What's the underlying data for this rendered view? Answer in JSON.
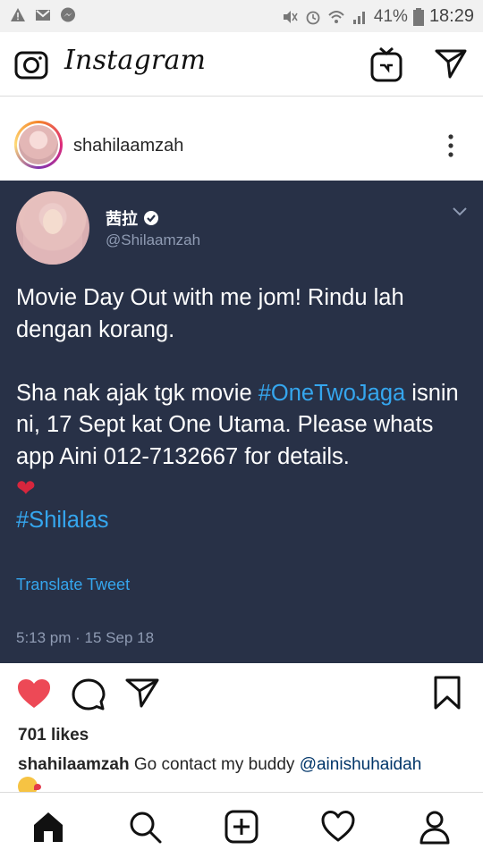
{
  "status_bar": {
    "battery": "41%",
    "time": "18:29"
  },
  "topbar": {
    "logo_text": "Instagram",
    "camera_icon": "camera-icon",
    "igtv_icon": "igtv-icon",
    "direct_icon": "paper-plane-icon"
  },
  "post": {
    "username": "shahilaamzah",
    "more_icon": "more-vertical-icon"
  },
  "tweet": {
    "display_name": "茜拉",
    "handle": "@Shilaamzah",
    "text_line1": "Movie Day Out with me jom! Rindu lah dengan korang.",
    "text_line2_prefix": "Sha nak ajak tgk movie ",
    "hashtag1": "#OneTwoJaga",
    "text_line2_suffix": " isnin ni, 17 Sept kat One Utama. Please whats app Aini 012-7132667 for details.",
    "heart_emoji": "❤",
    "hashtag2": "#Shilalas",
    "translate_label": "Translate Tweet",
    "timestamp": "5:13 pm · 15 Sep 18"
  },
  "actions": {
    "like_icon": "heart-filled-icon",
    "comment_icon": "comment-icon",
    "share_icon": "share-icon",
    "save_icon": "bookmark-icon"
  },
  "likes_text": "701 likes",
  "caption": {
    "username": "shahilaamzah",
    "text": " Go contact my buddy ",
    "mention": "@ainishuhaidah"
  },
  "bottom_nav": {
    "items": [
      "home-icon",
      "search-icon",
      "add-post-icon",
      "activity-heart-icon",
      "profile-icon"
    ]
  },
  "colors": {
    "tweet_bg": "#283147",
    "tweet_link": "#35a6ee",
    "like_red": "#ed4956"
  }
}
